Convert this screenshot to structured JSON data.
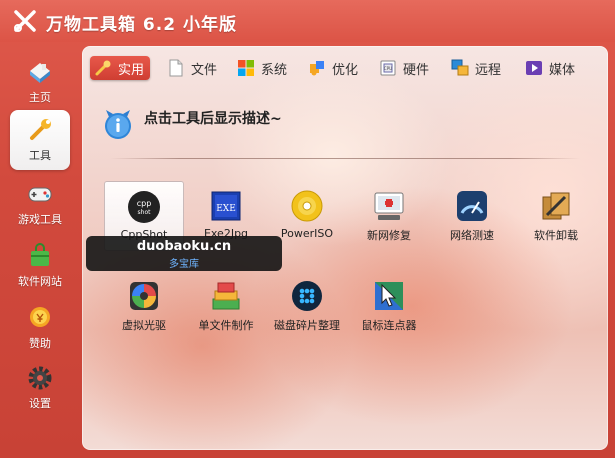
{
  "app": {
    "title": "万物工具箱 6.2 小年版"
  },
  "sidebar": {
    "items": [
      {
        "label": "主页",
        "icon": "home-icon"
      },
      {
        "label": "工具",
        "icon": "wrench-icon",
        "active": true
      },
      {
        "label": "游戏工具",
        "icon": "gamepad-icon"
      },
      {
        "label": "软件网站",
        "icon": "bag-icon"
      },
      {
        "label": "赞助",
        "icon": "coin-icon"
      },
      {
        "label": "设置",
        "icon": "gear-icon"
      }
    ]
  },
  "tabs": [
    {
      "label": "实用",
      "icon": "wrench-icon",
      "active": true
    },
    {
      "label": "文件",
      "icon": "document-icon"
    },
    {
      "label": "系统",
      "icon": "windows-logo-icon"
    },
    {
      "label": "优化",
      "icon": "puzzle-icon"
    },
    {
      "label": "硬件",
      "icon": "cpu-icon"
    },
    {
      "label": "远程",
      "icon": "remote-windows-icon"
    },
    {
      "label": "媒体",
      "icon": "play-icon"
    }
  ],
  "description": {
    "text": "点击工具后显示描述~"
  },
  "tools": [
    {
      "label": "CppShot",
      "icon": "cppshot-icon",
      "selected": true
    },
    {
      "label": "Exe2Jpg",
      "icon": "exe-icon"
    },
    {
      "label": "PowerISO",
      "icon": "disc-icon"
    },
    {
      "label": "新网修复",
      "icon": "network-repair-icon"
    },
    {
      "label": "网络测速",
      "icon": "speedometer-icon"
    },
    {
      "label": "软件卸载",
      "icon": "uninstall-icon"
    },
    {
      "label": "虚拟光驱",
      "icon": "virtual-drive-icon"
    },
    {
      "label": "单文件制作",
      "icon": "single-file-icon"
    },
    {
      "label": "磁盘碎片整理",
      "icon": "defrag-icon"
    },
    {
      "label": "鼠标连点器",
      "icon": "mouse-clicker-icon"
    }
  ],
  "watermark": {
    "title": "duobaoku.cn",
    "subtitle": "多宝库"
  }
}
